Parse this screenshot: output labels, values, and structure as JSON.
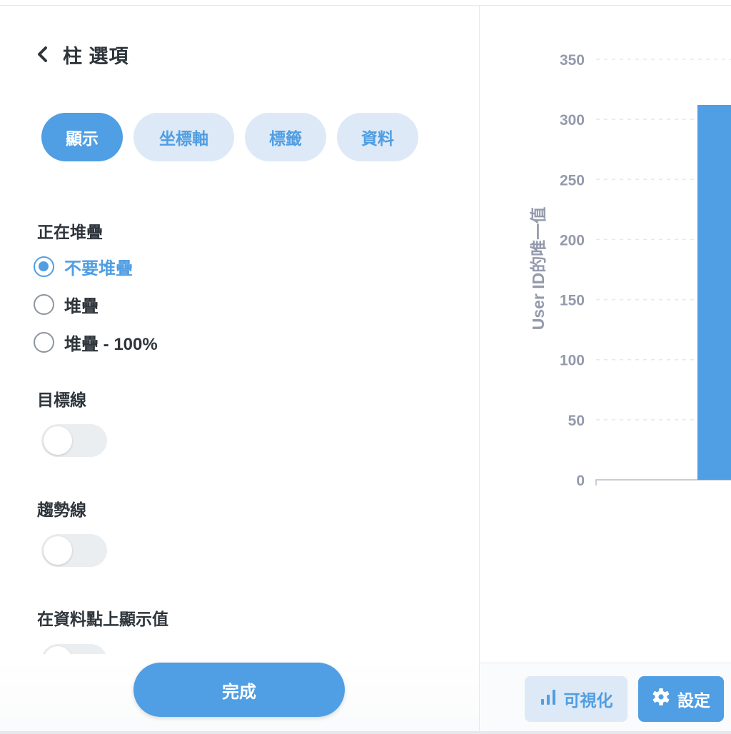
{
  "settings": {
    "title": "柱 選項",
    "tabs": [
      {
        "label": "顯示",
        "active": true
      },
      {
        "label": "坐標軸",
        "active": false
      },
      {
        "label": "標籤",
        "active": false
      },
      {
        "label": "資料",
        "active": false
      }
    ],
    "stacking": {
      "label": "正在堆疊",
      "options": [
        {
          "label": "不要堆疊",
          "checked": true
        },
        {
          "label": "堆疊",
          "checked": false
        },
        {
          "label": "堆疊 - 100%",
          "checked": false
        }
      ]
    },
    "goal_line": {
      "label": "目標線",
      "enabled": false
    },
    "trend_line": {
      "label": "趨勢線",
      "enabled": false
    },
    "show_values": {
      "label": "在資料點上顯示值",
      "enabled": false
    },
    "done_label": "完成"
  },
  "footer": {
    "visualization_label": "可視化",
    "settings_label": "設定"
  },
  "colors": {
    "accent": "#509ee3",
    "accent_light": "#dde9f6",
    "text_dark": "#2e353b",
    "axis_text": "#949aab"
  },
  "chart_data": {
    "type": "bar",
    "ylabel": "User ID的唯一值",
    "ylim": [
      0,
      350
    ],
    "yticks": [
      "0",
      "50",
      "100",
      "150",
      "200",
      "250",
      "300",
      "350"
    ],
    "grid": true,
    "series": [
      {
        "values": [
          312
        ]
      }
    ]
  }
}
